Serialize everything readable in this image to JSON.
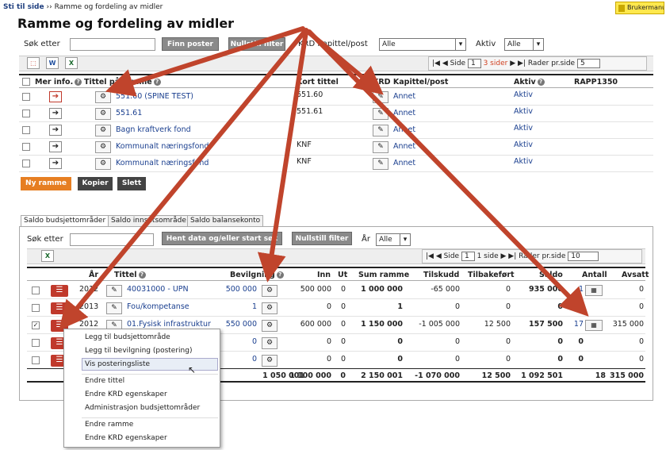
{
  "breadcrumb": {
    "lead": "Sti til side",
    "sep": "››",
    "current": "Ramme og fordeling av midler"
  },
  "help_button": "Brukermanu",
  "page_title": "Ramme og fordeling av midler",
  "top_filter": {
    "search_label": "Søk etter",
    "search_value": "",
    "find_button": "Finn poster",
    "reset_button": "Nullstill filter",
    "krd_label": "KRD Kapittel/post",
    "krd_value": "Alle",
    "active_label": "Aktiv",
    "active_value": "Alle"
  },
  "top_toolbar": {
    "icons": [
      "pdf-icon",
      "word-icon",
      "excel-icon"
    ],
    "pager_label": "Side",
    "page": "1",
    "pages_text": "3 sider",
    "rows_label": "Rader pr.side",
    "rows_value": "5"
  },
  "top_table": {
    "headers": [
      "Mer info.",
      "Tittel på ramme",
      "Kort tittel",
      "KRD Kapittel/post",
      "Aktiv",
      "RAPP1350"
    ],
    "rows": [
      {
        "title": "551.60 (SPINE TEST)",
        "short": "551.60",
        "krd": "Annet",
        "active": "Aktiv"
      },
      {
        "title": "551.61",
        "short": "551.61",
        "krd": "Annet",
        "active": "Aktiv"
      },
      {
        "title": "Bagn kraftverk fond",
        "short": "",
        "krd": "Annet",
        "active": "Aktiv"
      },
      {
        "title": "Kommunalt næringsfond",
        "short": "KNF",
        "krd": "Annet",
        "active": "Aktiv"
      },
      {
        "title": "Kommunalt næringsfond",
        "short": "KNF",
        "krd": "Annet",
        "active": "Aktiv"
      }
    ]
  },
  "top_buttons": {
    "new": "Ny ramme",
    "copy": "Kopier",
    "delete": "Slett"
  },
  "tabs": [
    "Saldo budsjettområder",
    "Saldo innsatsområde",
    "Saldo balansekonto"
  ],
  "bottom_filter": {
    "search_label": "Søk etter",
    "fetch_button": "Hent data og/eller start søk",
    "reset_button": "Nullstill filter",
    "year_label": "År",
    "year_value": "Alle"
  },
  "bottom_toolbar": {
    "pager_label": "Side",
    "page": "1",
    "pages_text": "1 side",
    "rows_label": "Rader pr.side",
    "rows_value": "10"
  },
  "bottom_table": {
    "headers": [
      "År",
      "Tittel",
      "Bevilgning",
      "Inn",
      "Ut",
      "Sum ramme",
      "Tilskudd",
      "Tilbakeført",
      "Saldo",
      "Antall",
      "Avsatt"
    ],
    "rows": [
      {
        "year": "2012",
        "title": "40031000 - UPN",
        "bev": "500 000",
        "inn": "500 000",
        "ut": "0",
        "sum": "1 000 000",
        "tilskudd": "-65 000",
        "tilbake": "0",
        "saldo": "935 000",
        "antall": "1",
        "avsatt": "0",
        "checked": false
      },
      {
        "year": "2013",
        "title": "Fou/kompetanse",
        "bev": "1",
        "inn": "0",
        "ut": "0",
        "sum": "1",
        "tilskudd": "0",
        "tilbake": "0",
        "saldo": "0",
        "antall": "0",
        "avsatt": "0",
        "checked": false
      },
      {
        "year": "2012",
        "title": "01.Fysisk infrastruktur",
        "bev": "550 000",
        "inn": "600 000",
        "ut": "0",
        "sum": "1 150 000",
        "tilskudd": "-1 005 000",
        "tilbake": "12 500",
        "saldo": "157 500",
        "antall": "17",
        "avsatt": "315 000",
        "checked": true
      },
      {
        "year": "",
        "title": "",
        "bev": "0",
        "inn": "0",
        "ut": "0",
        "sum": "0",
        "tilskudd": "0",
        "tilbake": "0",
        "saldo": "0",
        "antall": "0",
        "avsatt": "0",
        "checked": false
      },
      {
        "year": "",
        "title": "",
        "bev": "0",
        "inn": "0",
        "ut": "0",
        "sum": "0",
        "tilskudd": "0",
        "tilbake": "0",
        "saldo": "0",
        "antall": "0",
        "avsatt": "0",
        "checked": false
      }
    ],
    "totals": {
      "bev": "1 050 001",
      "inn": "1 100 000",
      "ut": "0",
      "sum": "2 150 001",
      "tilskudd": "-1 070 000",
      "tilbake": "12 500",
      "saldo": "1 092 501",
      "antall": "18",
      "avsatt": "315 000"
    }
  },
  "context_menu": [
    "Legg til budsjettområde",
    "Legg til bevilgning (postering)",
    "Vis posteringsliste",
    "Endre tittel",
    "Endre KRD egenskaper",
    "Administrasjon budsjettområder",
    "Endre ramme",
    "Endre KRD egenskaper"
  ],
  "colors": {
    "accent": "#e67e22",
    "arrow": "#c0442c",
    "menu_red": "#c0392b",
    "link": "#1a3f8f"
  }
}
